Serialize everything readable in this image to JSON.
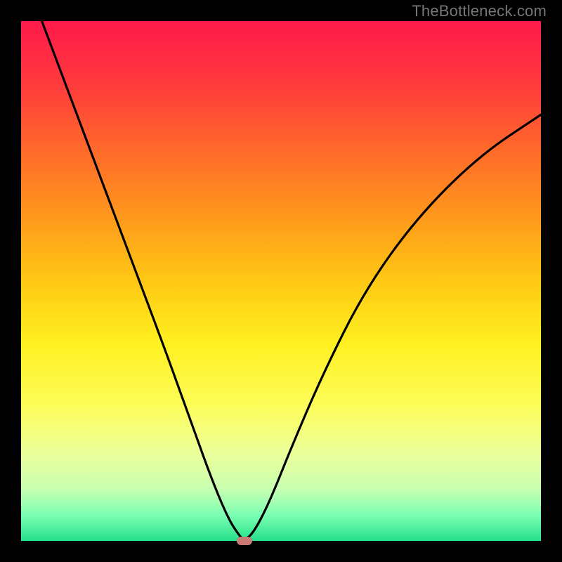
{
  "watermark": "TheBottleneck.com",
  "chart_data": {
    "type": "line",
    "title": "",
    "xlabel": "",
    "ylabel": "",
    "xlim": [
      0,
      100
    ],
    "ylim": [
      0,
      100
    ],
    "grid": false,
    "legend": false,
    "series": [
      {
        "name": "bottleneck-curve",
        "x": [
          4,
          10,
          16,
          22,
          28,
          33,
          37,
          40,
          42,
          43,
          45,
          48,
          52,
          58,
          66,
          76,
          88,
          100
        ],
        "y": [
          100,
          84,
          68,
          52,
          36,
          22,
          11,
          4,
          1,
          0,
          2,
          8,
          18,
          32,
          48,
          62,
          74,
          82
        ]
      }
    ],
    "marker": {
      "x": 43,
      "y": 0,
      "color": "#c97a74"
    },
    "gradient_stops": [
      {
        "pos": 0,
        "color": "#ff1a4b"
      },
      {
        "pos": 12,
        "color": "#ff3a3d"
      },
      {
        "pos": 25,
        "color": "#ff6a2a"
      },
      {
        "pos": 38,
        "color": "#ff9a1c"
      },
      {
        "pos": 50,
        "color": "#ffc814"
      },
      {
        "pos": 62,
        "color": "#fff020"
      },
      {
        "pos": 74,
        "color": "#fdfd5a"
      },
      {
        "pos": 83,
        "color": "#ecff9a"
      },
      {
        "pos": 90,
        "color": "#c8ffb0"
      },
      {
        "pos": 95,
        "color": "#7cffb3"
      },
      {
        "pos": 100,
        "color": "#24e08b"
      }
    ]
  }
}
